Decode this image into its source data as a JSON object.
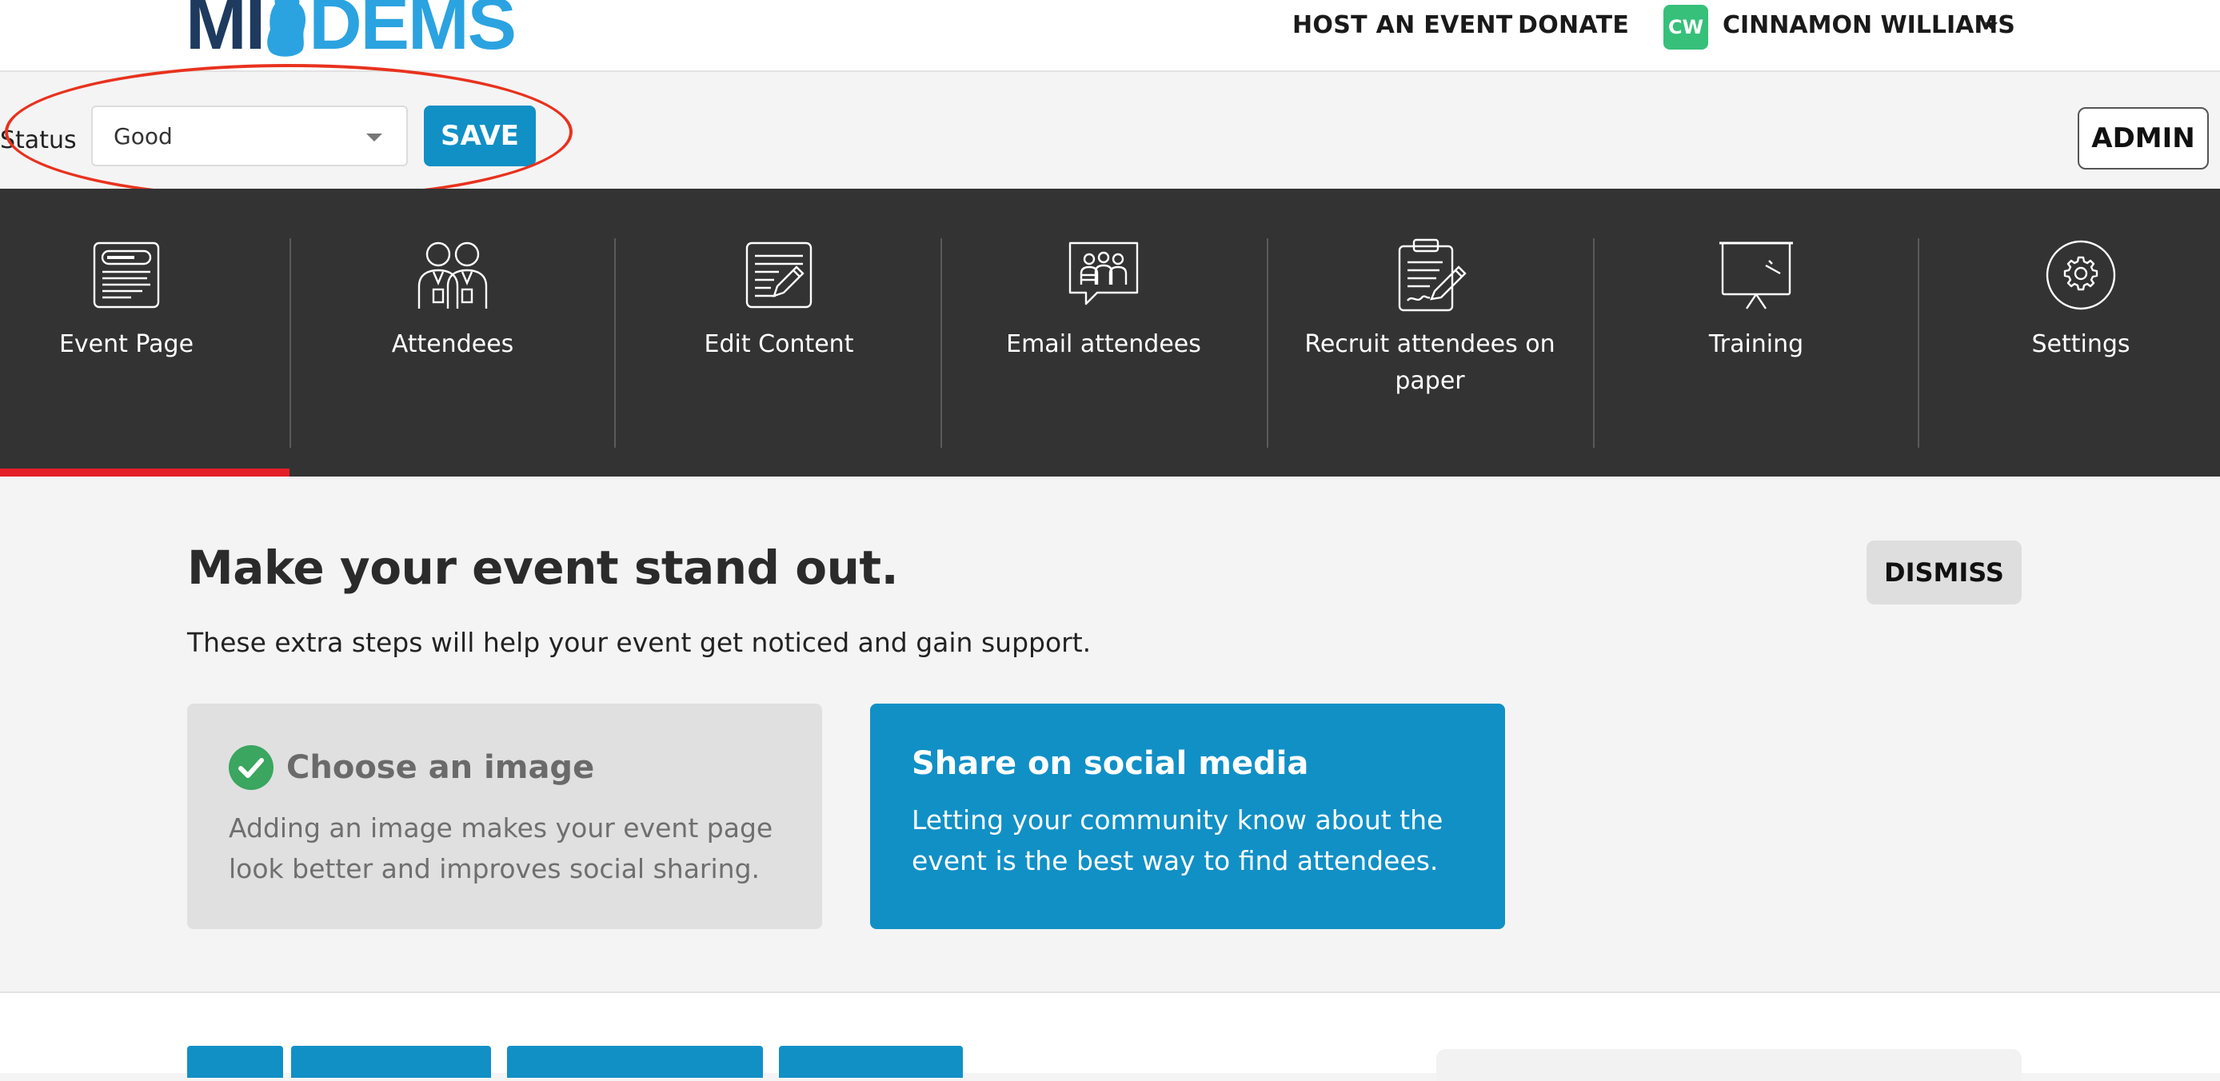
{
  "header": {
    "logo": {
      "left": "MI",
      "right": "DEMS"
    },
    "nav": {
      "host_event": "HOST AN EVENT",
      "donate": "DONATE"
    },
    "user": {
      "initials": "CW",
      "name": "CINNAMON WILLIAMS"
    }
  },
  "status_bar": {
    "label": "Status",
    "selected": "Good",
    "save_label": "SAVE",
    "admin_label": "ADMIN"
  },
  "event_nav": {
    "items": [
      {
        "label": "Event Page",
        "icon": "event-page-icon",
        "active": true
      },
      {
        "label": "Attendees",
        "icon": "attendees-icon"
      },
      {
        "label": "Edit Content",
        "icon": "edit-content-icon"
      },
      {
        "label": "Email attendees",
        "icon": "email-attendees-icon"
      },
      {
        "label": "Recruit attendees on paper",
        "icon": "clipboard-icon"
      },
      {
        "label": "Training",
        "icon": "training-icon"
      },
      {
        "label": "Settings",
        "icon": "settings-icon"
      }
    ]
  },
  "promo": {
    "title": "Make your event stand out.",
    "subtitle": "These extra steps will help your event get noticed and gain support.",
    "dismiss_label": "DISMISS",
    "cards": [
      {
        "title": "Choose an image",
        "text": "Adding an image makes your event page look better and improves social sharing.",
        "done": true
      },
      {
        "title": "Share on social media",
        "text": "Letting your community know about the event is the best way to find attendees.",
        "done": false
      }
    ]
  },
  "colors": {
    "brand_blue": "#1190c6",
    "logo_navy": "#1e3a5f",
    "logo_sky": "#2ba3e0",
    "nav_band": "#333333",
    "active_red": "#e41e26",
    "annotation_red": "#e8321e",
    "avatar_green": "#36c07a",
    "check_green": "#3aa660"
  }
}
